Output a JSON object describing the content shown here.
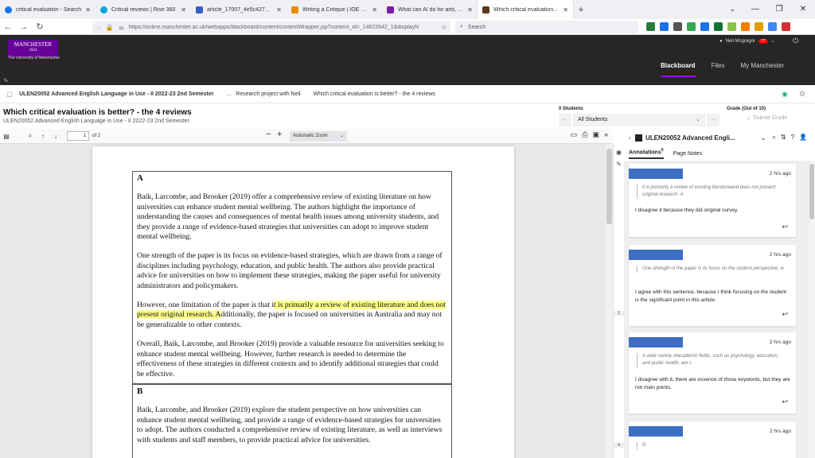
{
  "browser": {
    "tabs": [
      {
        "label": "critical evaluation - Search",
        "color": "#1a73e8",
        "active": false
      },
      {
        "label": "Critical reviews | Rise 360",
        "color": "#00a3e0",
        "active": false
      },
      {
        "label": "article_17007_4e5c4273c3f2a64(",
        "color": "#3a5fbf",
        "active": false
      },
      {
        "label": "Writing a Critique | IOE Writing",
        "color": "#e88a00",
        "active": false
      },
      {
        "label": "What can AI do for arts, culture",
        "color": "#7a1fa2",
        "active": false
      },
      {
        "label": "Which critical evaluation is bett",
        "color": "#5b3a1e",
        "active": true
      }
    ],
    "url": "https://online.manchester.ac.uk/webapps/blackboard/content/contentWrapper.jsp?content_id=_14622642_1&displayN",
    "search_placeholder": "Search",
    "extension_colors": [
      "#2a7a3a",
      "#1a73e8",
      "#555555",
      "#34a853",
      "#1a73e8",
      "#137333",
      "#8bc34a",
      "#f57c00",
      "#e0a000",
      "#4285f4",
      "#d32f2f"
    ]
  },
  "header": {
    "logo_text": "MANCHESTER",
    "logo_year": "1824",
    "logo_subtitle": "The University of Manchester",
    "user_name": "Neil Mcgregor",
    "notification_count": "77",
    "nav": [
      "Blackboard",
      "Files",
      "My Manchester"
    ]
  },
  "breadcrumb": {
    "course": "ULEN20052 Advanced English Language in Use - II 2022-23 2nd Semester",
    "ellipsis": "...",
    "item2": "Research project with Neil",
    "item3": "Which critical evaluation is better? - the 4 reviews"
  },
  "content_header": {
    "title": "Which critical evaluation is better? - the 4 reviews",
    "subtitle": "ULEN20052 Advanced English Language in Use - II 2022-23 2nd Semester",
    "students_label": "0 Students",
    "students_selected": "All Students",
    "grade_label": "Grade (Out of 10)",
    "submit_grade": "Submit Grade"
  },
  "pdf_toolbar": {
    "page_number": "1",
    "page_of": "of 2",
    "zoom": "Automatic Zoom"
  },
  "document": {
    "boxA": {
      "heading": "A",
      "p1": "Baik, Larcombe, and Brooker (2019) offer a comprehensive review of existing literature on how universities can enhance student mental wellbeing. The authors highlight the importance of understanding the causes and consequences of mental health issues among university students, and they provide a range of evidence-based strategies that universities can adopt to improve student mental wellbeing.",
      "p2": "One strength of the paper is its focus on evidence-based strategies, which are drawn from a range of disciplines including psychology, education, and public health. The authors also provide practical advice for universities on how to implement these strategies, making the paper useful for university administrators and policymakers.",
      "p3_before": "However, one limitation of the paper is that i",
      "p3_highlight": "t is primarily a review of existing literature and does not present original research. A",
      "p3_after": "dditionally, the paper is focused on universities in Australia and may not be generalizable to other contexts.",
      "p4": "Overall, Baik, Larcombe, and Brooker (2019) provide a valuable resource for universities seeking to enhance student mental wellbeing. However, further research is needed to determine the effectiveness of these strategies in different contexts and to identify additional strategies that could be effective."
    },
    "boxB": {
      "heading": "B",
      "p1": "Baik, Larcombe, and Brooker (2019) explore the student perspective on how universities can enhance student mental wellbeing, and provide a range of evidence-based strategies for universities to adopt. The authors conducted a comprehensive review of existing literature, as well as interviews with students and staff members, to provide practical advice for universities."
    }
  },
  "annotations_panel": {
    "title": "ULEN20052 Advanced Engli...",
    "tab_annotations": "Annotations",
    "tab_annotations_count": "5",
    "tab_page_notes": "Page Notes",
    "side_count": "1",
    "side_count2": "4",
    "cards": [
      {
        "time": "2 hrs ago",
        "quote": "it is primarily a review of existing literatureand does not present original research. A",
        "comment": "I disagree it because they did original survey."
      },
      {
        "time": "2 hrs ago",
        "quote": "One strength of the paper is its focus on the student perspective, w",
        "comment": "I agree with this sentence, because I think focusing on the student is the significant point in this article."
      },
      {
        "time": "2 hrs ago",
        "quote": "A wide variety ofacademic fields, such as psychology, education, and public health, are c",
        "comment": "I disagree with it, there are essence of those keywords, but they are not main points."
      },
      {
        "time": "2 hrs ago",
        "quote": "D",
        "comment": ""
      }
    ]
  }
}
